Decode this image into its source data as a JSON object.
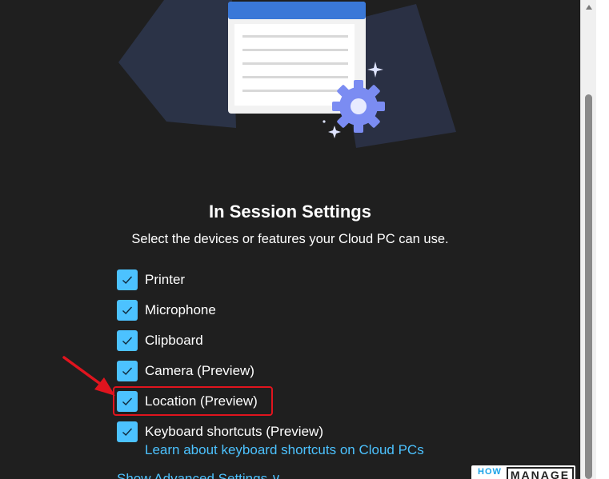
{
  "dialog": {
    "title": "In Session Settings",
    "subtitle": "Select the devices or features your Cloud PC can use."
  },
  "options": [
    {
      "label": "Printer",
      "checked": true
    },
    {
      "label": "Microphone",
      "checked": true
    },
    {
      "label": "Clipboard",
      "checked": true
    },
    {
      "label": "Camera (Preview)",
      "checked": true
    },
    {
      "label": "Location (Preview)",
      "checked": true
    },
    {
      "label": "Keyboard shortcuts (Preview)",
      "checked": true
    }
  ],
  "links": {
    "learn_shortcuts": "Learn about keyboard shortcuts on Cloud PCs",
    "advanced_settings": "Show Advanced Settings ∨"
  },
  "watermark": {
    "how": "HOW",
    "manage": "MANAGE"
  },
  "colors": {
    "background": "#1f1f1f",
    "accent": "#4cc2ff",
    "annotation": "#e0141e"
  },
  "icons": {
    "checkbox": "check-icon",
    "hero": "settings-gear-illustration",
    "annotation": "red-arrow-icon"
  }
}
